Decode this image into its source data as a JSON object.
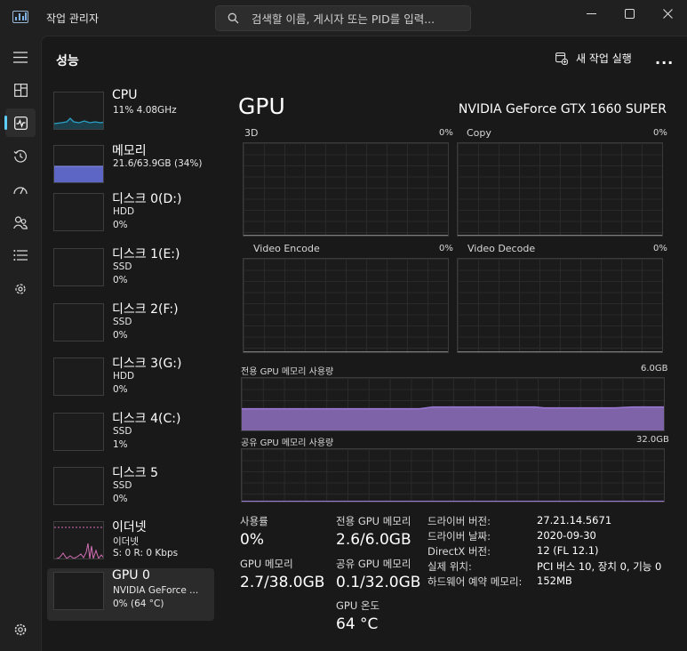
{
  "app": {
    "title": "작업 관리자"
  },
  "search": {
    "placeholder": "검색할 이름, 게시자 또는 PID를 입력..."
  },
  "nav": {
    "items": [
      "menu-icon",
      "processes-icon",
      "performance-icon",
      "history-icon",
      "startup-icon",
      "users-icon",
      "details-icon",
      "services-icon",
      "settings-icon"
    ],
    "active": "performance"
  },
  "header": {
    "title": "성능",
    "run_new_task": "새 작업 실행",
    "more": "..."
  },
  "devices": [
    {
      "name": "CPU",
      "line2": "11% 4.08GHz",
      "line3": ""
    },
    {
      "name": "메모리",
      "line2": "21.6/63.9GB (34%)",
      "line3": ""
    },
    {
      "name": "디스크 0(D:)",
      "line2": "HDD",
      "line3": "0%"
    },
    {
      "name": "디스크 1(E:)",
      "line2": "SSD",
      "line3": "0%"
    },
    {
      "name": "디스크 2(F:)",
      "line2": "SSD",
      "line3": "0%"
    },
    {
      "name": "디스크 3(G:)",
      "line2": "HDD",
      "line3": "0%"
    },
    {
      "name": "디스크 4(C:)",
      "line2": "SSD",
      "line3": "1%"
    },
    {
      "name": "디스크 5",
      "line2": "SSD",
      "line3": "0%"
    },
    {
      "name": "이더넷",
      "line2": "이더넷",
      "line3": "S: 0 R: 0 Kbps"
    },
    {
      "name": "GPU 0",
      "line2": "NVIDIA GeForce ...",
      "line3": "0% (64 °C)"
    }
  ],
  "detail": {
    "title": "GPU",
    "model": "NVIDIA GeForce GTX 1660 SUPER",
    "engines": [
      {
        "name": "3D",
        "value": "0%"
      },
      {
        "name": "Copy",
        "value": "0%"
      },
      {
        "name": "Video Encode",
        "value": "0%"
      },
      {
        "name": "Video Decode",
        "value": "0%"
      }
    ],
    "dedicated_label": "전용 GPU 메모리 사용량",
    "dedicated_max": "6.0GB",
    "dedicated_fraction": 0.43,
    "shared_label": "공유 GPU 메모리 사용량",
    "shared_max": "32.0GB",
    "stats": {
      "utilization_label": "사용률",
      "utilization": "0%",
      "gpu_memory_label": "GPU 메모리",
      "gpu_memory": "2.7/38.0GB",
      "dedicated_label": "전용 GPU 메모리",
      "dedicated": "2.6/6.0GB",
      "shared_label": "공유 GPU 메모리",
      "shared": "0.1/32.0GB",
      "temp_label": "GPU 온도",
      "temp": "64 °C"
    },
    "info": [
      {
        "key": "드라이버 버전:",
        "value": "27.21.14.5671"
      },
      {
        "key": "드라이버 날짜:",
        "value": "2020-09-30"
      },
      {
        "key": "DirectX 버전:",
        "value": "12 (FL 12.1)"
      },
      {
        "key": "실제 위치:",
        "value": "PCI 버스 10, 장치 0, 기능 0"
      },
      {
        "key": "하드웨어 예약 메모리:",
        "value": "152MB"
      }
    ]
  },
  "colors": {
    "cpu": "#2aa1c5",
    "memory": "#6671d6",
    "disk": "#3da36a",
    "ethernet": "#d36fb6",
    "gpu": "#9b7ad6",
    "accent": "#60cdff"
  }
}
